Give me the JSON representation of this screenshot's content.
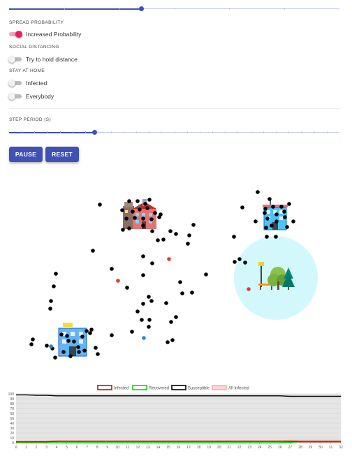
{
  "top_slider": {
    "value_fraction": 0.4,
    "tick_count": 6
  },
  "spread_probability": {
    "section_label": "SPREAD PROBABILITY",
    "increased_probability": {
      "label": "Increased Probability",
      "on": true
    }
  },
  "social_distancing": {
    "section_label": "SOCIAL DISTANCING",
    "hold_distance": {
      "label": "Try to hold distance",
      "on": false
    }
  },
  "stay_at_home": {
    "section_label": "STAY AT HOME",
    "infected": {
      "label": "Infected",
      "on": false
    },
    "everybody": {
      "label": "Everybody",
      "on": false
    }
  },
  "step_period": {
    "section_label": "STEP PERIOD (S)",
    "value_fraction": 0.26,
    "tick_count": 26
  },
  "buttons": {
    "pause_label": "PAUSE",
    "reset_label": "RESET"
  },
  "colors": {
    "accent": "#3f51b5",
    "toggle_on": "#e91e63",
    "infected": "#e53935",
    "recovered": "#1e88e5",
    "susceptible": "#000000",
    "park_zone": "#d3f8fb",
    "chart_infected": "#e00000",
    "chart_recovered": "#00dd00",
    "chart_susceptible": "#000000",
    "chart_all_infected": "#f4b0b0"
  },
  "simulation": {
    "locations": [
      {
        "name": "school-building-icon",
        "kind": "school"
      },
      {
        "name": "office-building-icon",
        "kind": "office"
      },
      {
        "name": "apartment-building-icon",
        "kind": "apartment"
      },
      {
        "name": "park-icon",
        "kind": "park"
      }
    ],
    "agents": {
      "infected_count": 3,
      "recovered_count": 2,
      "susceptible_count": 120
    }
  },
  "chart_data": {
    "type": "area",
    "legend": [
      "Infected",
      "Recovered",
      "Susceptible",
      "All Infected"
    ],
    "ylim": [
      0,
      100
    ],
    "y_ticks": [
      0,
      10,
      20,
      30,
      40,
      50,
      60,
      70,
      80,
      90,
      100
    ],
    "x": [
      0,
      1,
      2,
      3,
      4,
      5,
      6,
      7,
      8,
      9,
      10,
      11,
      12,
      13,
      14,
      15,
      16,
      17,
      18,
      19,
      20,
      21,
      22,
      23,
      24,
      25,
      26,
      27,
      28,
      29,
      30,
      31,
      32
    ],
    "series": [
      {
        "name": "Infected",
        "values": [
          2,
          2,
          2,
          2,
          3,
          3,
          3,
          3,
          3,
          3,
          3,
          3,
          3,
          3,
          3,
          3,
          3,
          3,
          3,
          3,
          3,
          3,
          3,
          3,
          3,
          3,
          3,
          3,
          2,
          2,
          2,
          2,
          2
        ]
      },
      {
        "name": "Recovered",
        "values": [
          0,
          0,
          0,
          0,
          0,
          0,
          0,
          0,
          0,
          0,
          0,
          0,
          0,
          0,
          0,
          0,
          0,
          0,
          0,
          0,
          0,
          0,
          0,
          0,
          0,
          0,
          0,
          1,
          2,
          2,
          2,
          2,
          2
        ]
      },
      {
        "name": "Susceptible",
        "values": [
          98,
          98,
          97,
          97,
          96,
          96,
          96,
          96,
          96,
          96,
          96,
          96,
          96,
          96,
          96,
          96,
          96,
          96,
          96,
          96,
          96,
          96,
          96,
          96,
          96,
          96,
          96,
          95,
          95,
          95,
          95,
          95,
          95
        ]
      },
      {
        "name": "All Infected",
        "values": [
          2,
          2,
          3,
          3,
          4,
          4,
          4,
          4,
          4,
          4,
          4,
          4,
          4,
          4,
          4,
          4,
          4,
          4,
          4,
          4,
          4,
          4,
          4,
          4,
          4,
          4,
          4,
          5,
          5,
          5,
          5,
          5,
          5
        ]
      }
    ]
  }
}
